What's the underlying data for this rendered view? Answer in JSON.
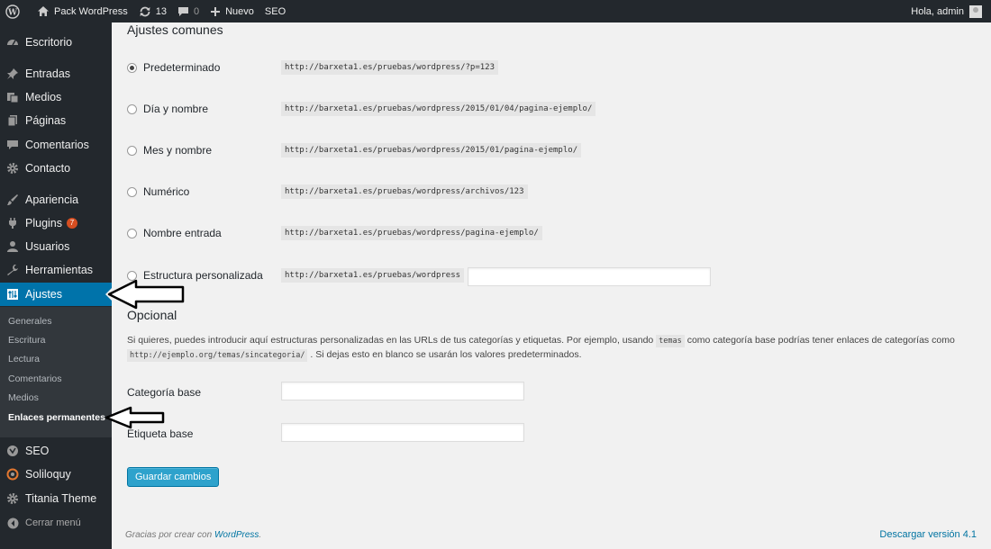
{
  "adminbar": {
    "site_name": "Pack WordPress",
    "updates_count": "13",
    "comments_count": "0",
    "new_label": "Nuevo",
    "seo_label": "SEO",
    "greeting": "Hola, admin"
  },
  "sidebar": {
    "items": [
      {
        "label": "Escritorio",
        "icon": "dashboard-icon"
      },
      {
        "label": "Entradas",
        "icon": "pin-icon"
      },
      {
        "label": "Medios",
        "icon": "media-icon"
      },
      {
        "label": "Páginas",
        "icon": "pages-icon"
      },
      {
        "label": "Comentarios",
        "icon": "comments-icon"
      },
      {
        "label": "Contacto",
        "icon": "gear-icon"
      },
      {
        "label": "Apariencia",
        "icon": "brush-icon"
      },
      {
        "label": "Plugins",
        "icon": "plug-icon",
        "badge": "7"
      },
      {
        "label": "Usuarios",
        "icon": "user-icon"
      },
      {
        "label": "Herramientas",
        "icon": "wrench-icon"
      },
      {
        "label": "Ajustes",
        "icon": "settings-icon"
      },
      {
        "label": "SEO",
        "icon": "seo-icon"
      },
      {
        "label": "Soliloquy",
        "icon": "slider-icon"
      },
      {
        "label": "Titania Theme",
        "icon": "gear-icon"
      }
    ],
    "submenu": [
      "Generales",
      "Escritura",
      "Lectura",
      "Comentarios",
      "Medios",
      "Enlaces permanentes"
    ],
    "collapse_label": "Cerrar menú"
  },
  "main": {
    "common_title": "Ajustes comunes",
    "options": [
      {
        "label": "Predeterminado",
        "example": "http://barxeta1.es/pruebas/wordpress/?p=123",
        "checked": true
      },
      {
        "label": "Día y nombre",
        "example": "http://barxeta1.es/pruebas/wordpress/2015/01/04/pagina-ejemplo/",
        "checked": false
      },
      {
        "label": "Mes y nombre",
        "example": "http://barxeta1.es/pruebas/wordpress/2015/01/pagina-ejemplo/",
        "checked": false
      },
      {
        "label": "Numérico",
        "example": "http://barxeta1.es/pruebas/wordpress/archivos/123",
        "checked": false
      },
      {
        "label": "Nombre entrada",
        "example": "http://barxeta1.es/pruebas/wordpress/pagina-ejemplo/",
        "checked": false
      },
      {
        "label": "Estructura personalizada",
        "example": "http://barxeta1.es/pruebas/wordpress",
        "checked": false,
        "value": ""
      }
    ],
    "optional_title": "Opcional",
    "desc_part1": "Si quieres, puedes introducir aquí estructuras personalizadas en las URLs de tus categorías y etiquetas. Por ejemplo, usando",
    "desc_code1": "temas",
    "desc_part2": "como categoría base podrías tener enlaces de categorías como",
    "desc_code2": "http://ejemplo.org/temas/sincategoria/",
    "desc_part3": ". Si dejas esto en blanco se usarán los valores predeterminados.",
    "category_base_label": "Categoría base",
    "category_base_value": "",
    "tag_base_label": "Etiqueta base",
    "tag_base_value": "",
    "save_label": "Guardar cambios"
  },
  "footer": {
    "thanks_prefix": "Gracias por crear con",
    "thanks_link": "WordPress",
    "thanks_suffix": ".",
    "version_link": "Descargar versión 4.1"
  }
}
